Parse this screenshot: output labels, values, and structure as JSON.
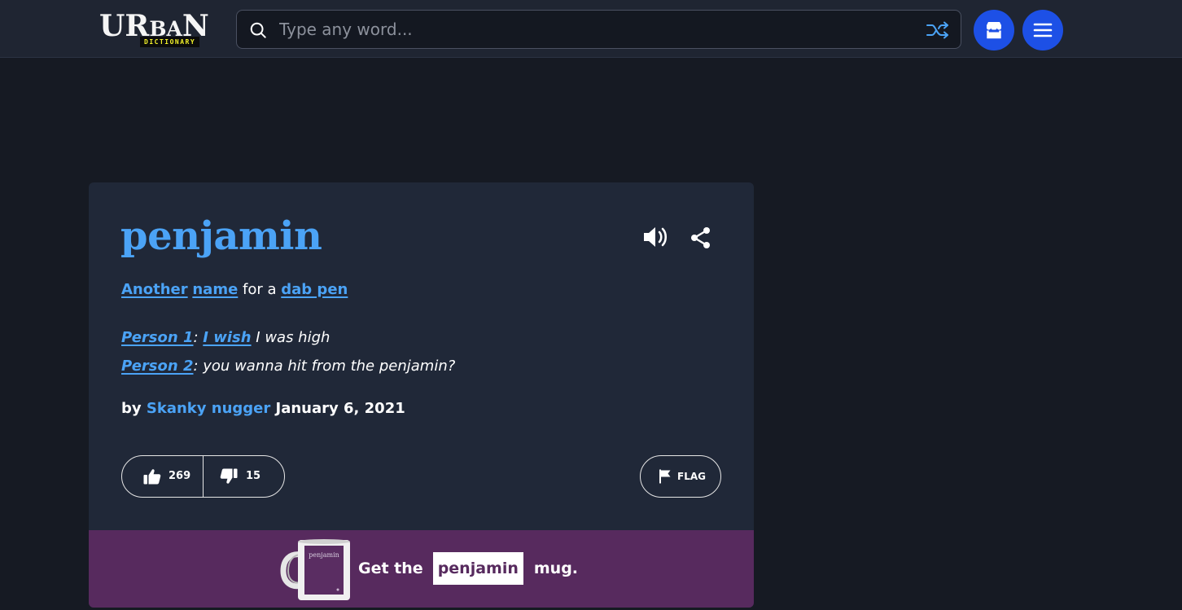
{
  "header": {
    "logo_word": "URbaN",
    "logo_sub": "DICTIONARY",
    "search_placeholder": "Type any word...",
    "search_value": "",
    "icons": [
      "search-icon",
      "shuffle-icon",
      "store-icon",
      "menu-icon"
    ],
    "accent_color": "#1d50e6"
  },
  "definition": {
    "word": "penjamin",
    "meaning": {
      "link1": "Another",
      "link2": "name",
      "text1": " for a ",
      "link3": "dab pen"
    },
    "example": {
      "line1_speaker": "Person 1",
      "line1_sep1": ": ",
      "line1_link": "I wish",
      "line1_text": " I was high",
      "line2_speaker": "Person 2",
      "line2_text": ": you wanna hit from the penjamin?"
    },
    "byline": {
      "prefix": "by ",
      "author": "Skanky nugger",
      "date": " January 6, 2021"
    },
    "votes": {
      "up": "269",
      "down": "15"
    },
    "flag_label": "FLAG",
    "link_color": "#4ba3f6"
  },
  "promo": {
    "mug_label": "penjamin",
    "prefix": "Get the",
    "word": "penjamin",
    "suffix": "mug.",
    "bg_color": "#572a5e"
  }
}
